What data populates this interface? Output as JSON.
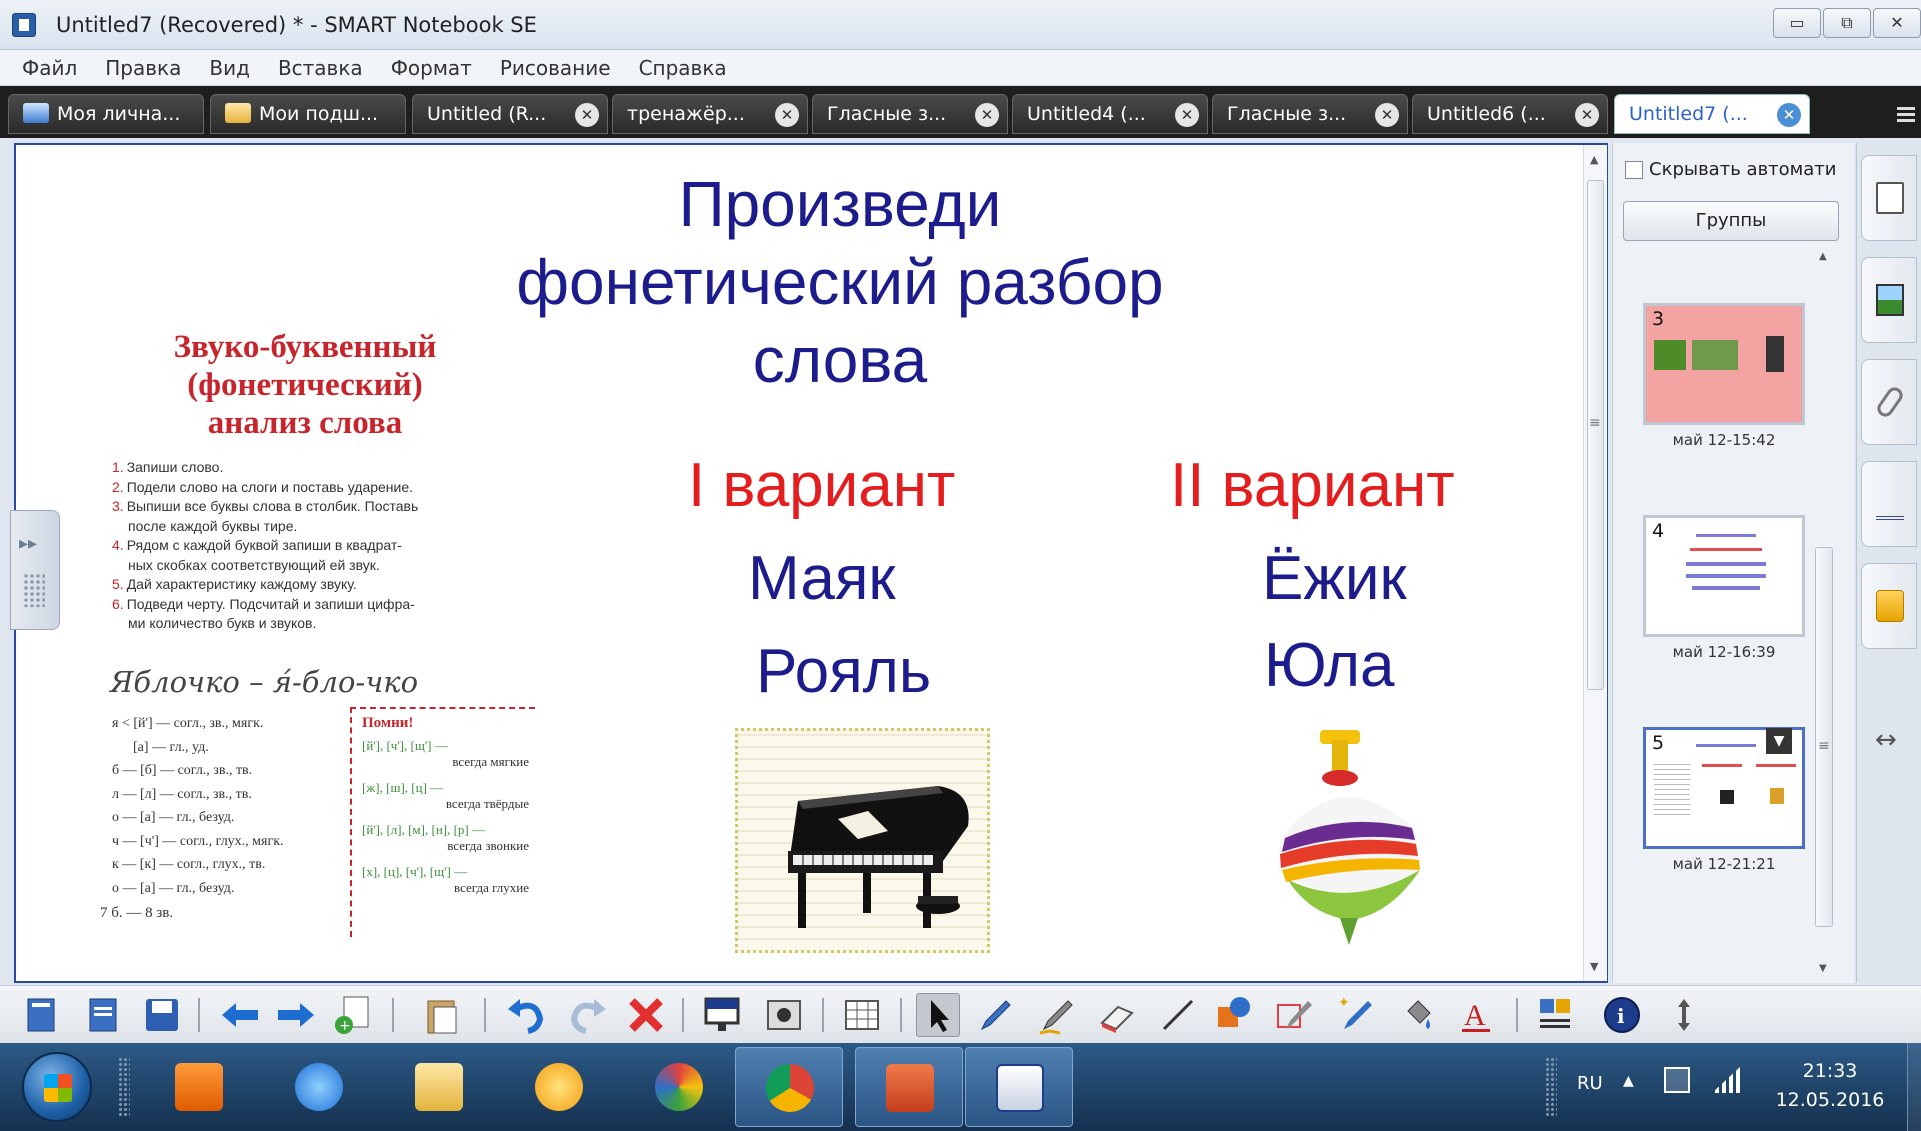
{
  "window": {
    "title": "Untitled7 (Recovered) * - SMART Notebook SE",
    "controls": [
      "▭",
      "⧉",
      "✕"
    ]
  },
  "menu": [
    "Файл",
    "Правка",
    "Вид",
    "Вставка",
    "Формат",
    "Рисование",
    "Справка"
  ],
  "tabs": [
    {
      "label": "Моя лична...",
      "icon": "gallery-icon"
    },
    {
      "label": "Мои подш...",
      "icon": "folder-icon"
    },
    {
      "label": "Untitled (R..."
    },
    {
      "label": "тренажёр..."
    },
    {
      "label": "Гласные з..."
    },
    {
      "label": "Untitled4 (..."
    },
    {
      "label": "Гласные з..."
    },
    {
      "label": "Untitled6 (..."
    },
    {
      "label": "Untitled7 (...",
      "active": true
    }
  ],
  "slide": {
    "title_lines": [
      "Произведи",
      "фонетический разбор",
      "слова"
    ],
    "variant1": {
      "heading": "I вариант",
      "words": [
        "Маяк",
        "Рояль"
      ]
    },
    "variant2": {
      "heading": "II вариант",
      "words": [
        "Ёжик",
        "Юла"
      ]
    },
    "book": {
      "title_lines": [
        "Звуко-буквенный",
        "(фонетический)",
        "анализ слова"
      ],
      "steps": [
        {
          "n": "1.",
          "text": "Запиши слово."
        },
        {
          "n": "2.",
          "text": "Подели слово на слоги и поставь ударение."
        },
        {
          "n": "3.",
          "text": "Выпиши все буквы слова в столбик. Поставь",
          "cont": "после каждой буквы тире."
        },
        {
          "n": "4.",
          "text": "Рядом с каждой буквой запиши в квадрат-",
          "cont": "ных скобках соответствующий ей звук."
        },
        {
          "n": "5.",
          "text": "Дай характеристику каждому звуку."
        },
        {
          "n": "6.",
          "text": "Подведи черту. Подсчитай и запиши цифра-",
          "cont": "ми количество букв и звуков."
        }
      ],
      "example": "Яблочко – я́-бло-чко",
      "analysis": [
        "я < [й'] — согл., зв., мягк.",
        "      [а] — гл., уд.",
        "б — [б] — согл., зв., тв.",
        "л — [л] — согл., зв., тв.",
        "о — [а] — гл., безуд.",
        "ч — [ч'] — согл., глух., мягк.",
        "к — [к] — согл., глух., тв.",
        "о — [а] — гл., безуд."
      ],
      "total": "7 б. — 8 зв.",
      "remember": {
        "heading": "Помни!",
        "rules": [
          {
            "sounds": "[й'], [ч'], [щ'] —",
            "note": "всегда мягкие"
          },
          {
            "sounds": "[ж], [ш], [ц] —",
            "note": "всегда твёрдые"
          },
          {
            "sounds": "[й'], [л], [м], [н], [р] —",
            "note": "всегда звонкие"
          },
          {
            "sounds": "[х], [ц], [ч'], [щ'] —",
            "note": "всегда глухие"
          }
        ]
      }
    }
  },
  "page_sorter": {
    "autohide_label": "Скрывать автомати",
    "groups_label": "Группы",
    "pages": [
      {
        "number": "3",
        "stamp": "май 12-15:42"
      },
      {
        "number": "4",
        "stamp": "май 12-16:39"
      },
      {
        "number": "5",
        "stamp": "май 12-21:21"
      }
    ]
  },
  "taskbar": {
    "language": "RU",
    "time": "21:33",
    "date": "12.05.2016"
  },
  "colors": {
    "slide_blue": "#1c1c8c",
    "slide_red": "#e41e1e",
    "book_red": "#c8242c",
    "frame_blue": "#2a4aa0"
  }
}
